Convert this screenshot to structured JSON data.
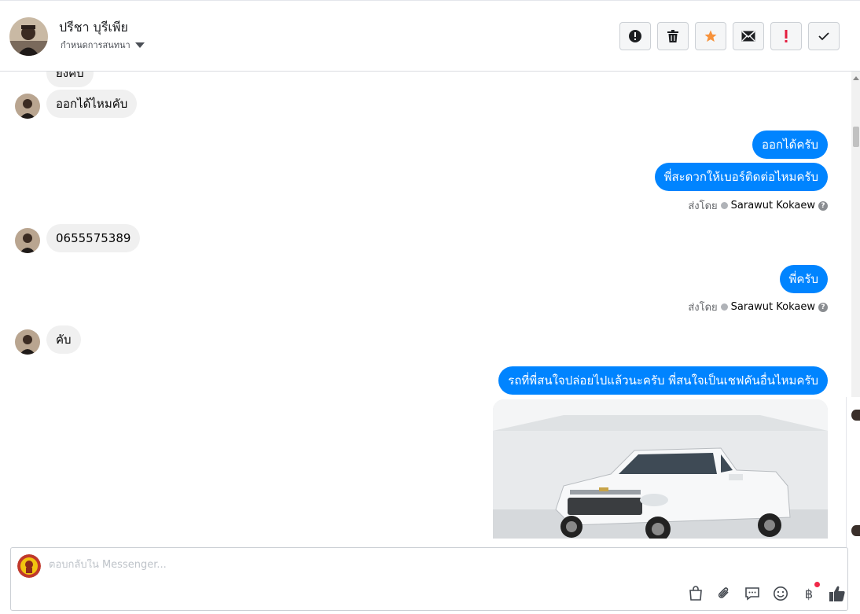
{
  "header": {
    "contact_name": "ปรีชา บุรีเพีย",
    "assign_label": "กำหนดการสนทนา"
  },
  "actions": [
    {
      "name": "spam-button",
      "icon": "alert-circle-icon"
    },
    {
      "name": "delete-button",
      "icon": "trash-icon"
    },
    {
      "name": "star-button",
      "icon": "star-icon",
      "color": "#f7923b"
    },
    {
      "name": "mark-unread-button",
      "icon": "envelope-icon"
    },
    {
      "name": "follow-up-button",
      "icon": "exclamation-icon",
      "color": "#e41e3f"
    },
    {
      "name": "mark-done-button",
      "icon": "check-icon"
    }
  ],
  "messages": {
    "m0": "ยังคับ",
    "m1": "ออกได้ไหมคับ",
    "m2": "ออกได้ครับ",
    "m3": "พี่สะดวกให้เบอร์ติดต่อไหมครับ",
    "m4": "0655575389",
    "m5": "พี่ครับ",
    "m6": "คับ",
    "m7": "รถที่พี่สนใจปล่อยไปแล้วนะครับ พี่สนใจเป็นเชฟคันอื่นไหมครับ"
  },
  "sent_by": {
    "prefix": "ส่งโดย",
    "sender": "Sarawut Kokaew"
  },
  "composer": {
    "placeholder": "ตอบกลับใน Messenger...",
    "baht_symbol": "฿"
  },
  "colors": {
    "outgoing_bubble": "#0084ff",
    "incoming_bubble": "#f0f0f0",
    "notification_dot": "#f02849"
  }
}
